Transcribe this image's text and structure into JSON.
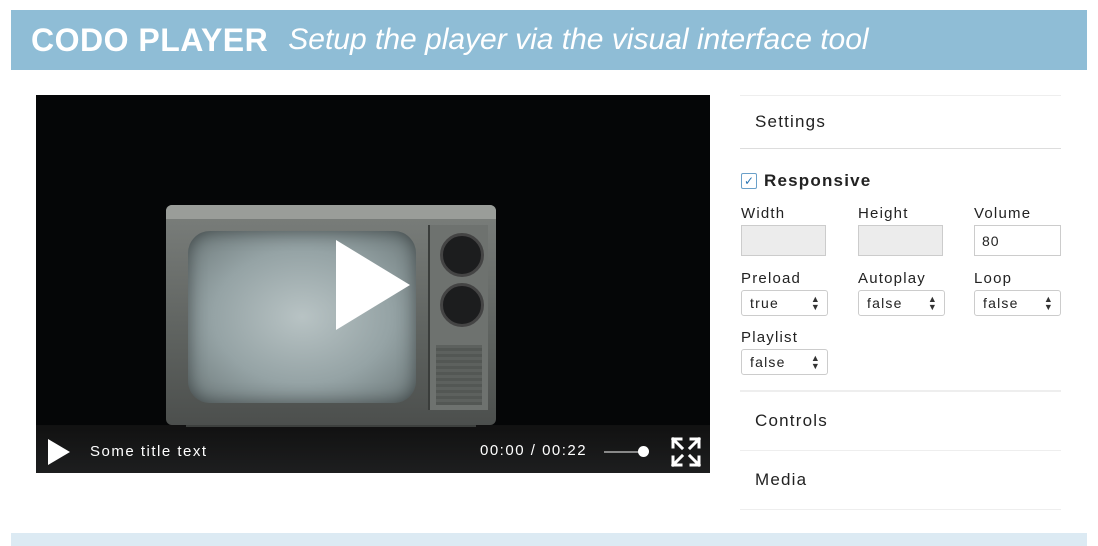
{
  "header": {
    "brand": "CODO PLAYER",
    "tagline": "Setup the player via the visual interface tool"
  },
  "player": {
    "title": "Some title text",
    "time_current": "00:00",
    "time_separator": "/",
    "time_total": "00:22",
    "volume_level_percent": 100
  },
  "settings": {
    "heading": "Settings",
    "responsive_label": "Responsive",
    "responsive_checked": true,
    "width_label": "Width",
    "width_value": "",
    "height_label": "Height",
    "height_value": "",
    "volume_label": "Volume",
    "volume_value": "80",
    "preload_label": "Preload",
    "preload_value": "true",
    "autoplay_label": "Autoplay",
    "autoplay_value": "false",
    "loop_label": "Loop",
    "loop_value": "false",
    "playlist_label": "Playlist",
    "playlist_value": "false"
  },
  "sections": {
    "controls": "Controls",
    "media": "Media"
  },
  "colors": {
    "header_bg": "#8fbdd6",
    "footer_bg": "#dceaf3",
    "checkbox_accent": "#2a76b5"
  },
  "icons": {
    "play": "play-icon",
    "fullscreen": "fullscreen-icon",
    "check": "checkmark-icon",
    "select_arrows": "updown-arrows-icon"
  }
}
